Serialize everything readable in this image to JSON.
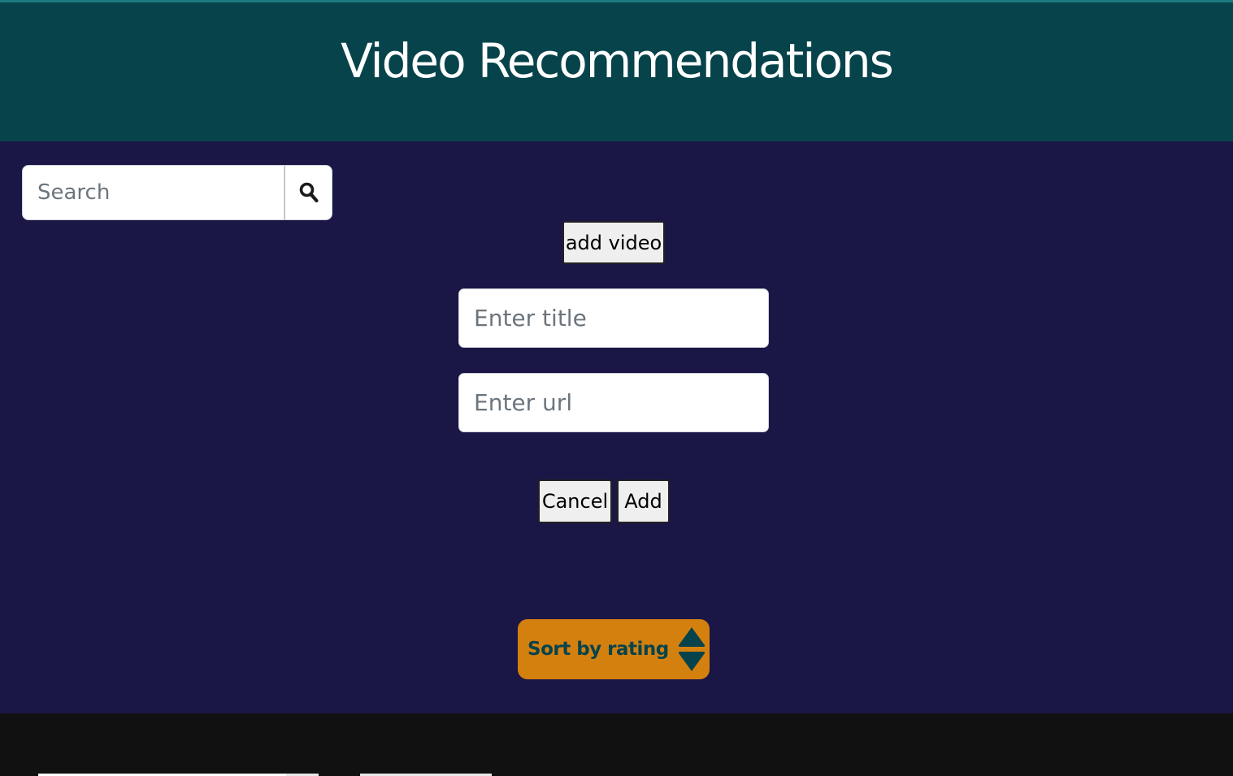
{
  "header": {
    "title": "Video Recommendations"
  },
  "search": {
    "placeholder": "Search",
    "button_icon": "search-icon"
  },
  "add_video": {
    "button_label": "add video",
    "title_placeholder": "Enter title",
    "url_placeholder": "Enter url",
    "cancel_label": "Cancel",
    "add_label": "Add"
  },
  "sort": {
    "label": "Sort by rating",
    "icon": "sort-icon"
  },
  "colors": {
    "header_bg": "#07434b",
    "main_bg": "#1a1646",
    "footer_bg": "#111111",
    "sort_button_bg": "#d4800f",
    "sort_button_text": "#07434b"
  }
}
